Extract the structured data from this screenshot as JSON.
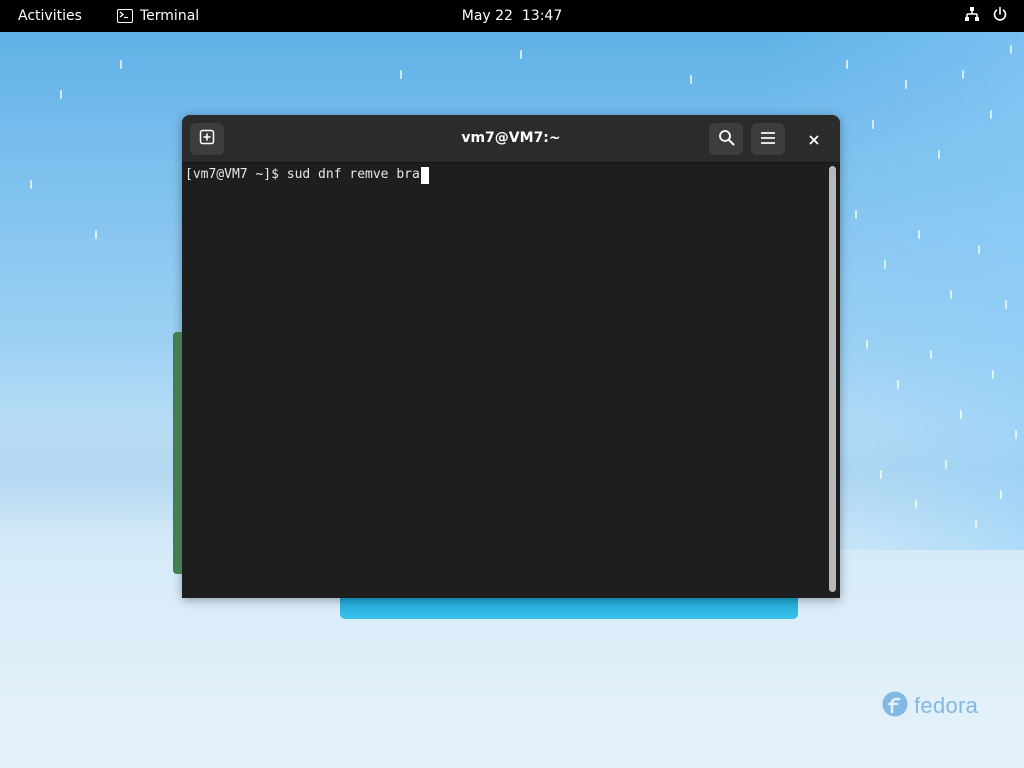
{
  "topbar": {
    "activities_label": "Activities",
    "app_name": "Terminal",
    "app_icon": "terminal-icon",
    "date": "May 22",
    "time": "13:47",
    "network_icon": "network-wired-icon",
    "power_icon": "power-icon"
  },
  "terminal": {
    "title": "vm7@VM7:~",
    "new_tab_icon": "new-tab-icon",
    "search_icon": "search-icon",
    "menu_icon": "hamburger-menu-icon",
    "close_icon": "close-icon",
    "prompt": "[vm7@VM7 ~]$ ",
    "command": "sud dnf remve bra"
  },
  "desktop": {
    "logo_text": "fedora",
    "accent_color": "#39c0ea",
    "topbar_color": "#000000",
    "terminal_bg": "#1e1e1e"
  }
}
